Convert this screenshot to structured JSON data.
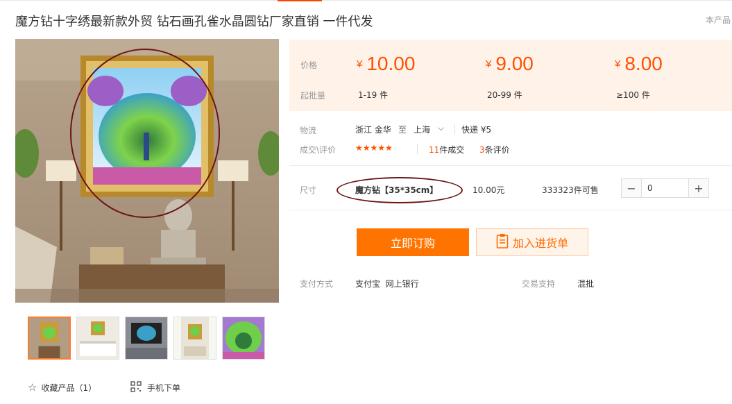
{
  "product": {
    "title": "魔方钻十字绣最新款外贸 钻石画孔雀水晶圆钻厂家直销 一件代发",
    "right_hint": "本产品"
  },
  "gallery": {
    "thumbnails": [
      "thumb-1",
      "thumb-2",
      "thumb-3",
      "thumb-4",
      "thumb-5"
    ],
    "active_index": 0
  },
  "actions_bottom": {
    "favorite_label": "收藏产品（1）",
    "mobile_label": "手机下单"
  },
  "pricing": {
    "price_label": "价格",
    "moq_label": "起批量",
    "currency": "¥",
    "tiers": [
      {
        "price": "10.00",
        "range": "1-19 件"
      },
      {
        "price": "9.00",
        "range": "20-99 件"
      },
      {
        "price": "8.00",
        "range": "≥100 件"
      }
    ]
  },
  "logistics": {
    "label": "物流",
    "from": "浙江 金华",
    "to_word": "至",
    "to": "上海",
    "shipping": "快递 ¥5"
  },
  "reviews": {
    "label": "成交\\评价",
    "stars": "★★★★★",
    "deals_count": "11",
    "deals_suffix": "件成交",
    "review_count": "3",
    "review_suffix": "条评价"
  },
  "sku": {
    "size_label": "尺寸",
    "option_name": "魔方钻【35*35cm】",
    "option_price": "10.00元",
    "stock": "333323件可售",
    "quantity": "0",
    "minus": "−",
    "plus": "+"
  },
  "buttons": {
    "buy_now": "立即订购",
    "add_to_list": "加入进货单"
  },
  "payment": {
    "label": "支付方式",
    "methods": "支付宝  网上银行",
    "support_label": "交易支持",
    "support_value": "混批"
  },
  "colors": {
    "accent": "#ff5000",
    "button_orange": "#ff7300",
    "annotation": "#6e1414"
  }
}
